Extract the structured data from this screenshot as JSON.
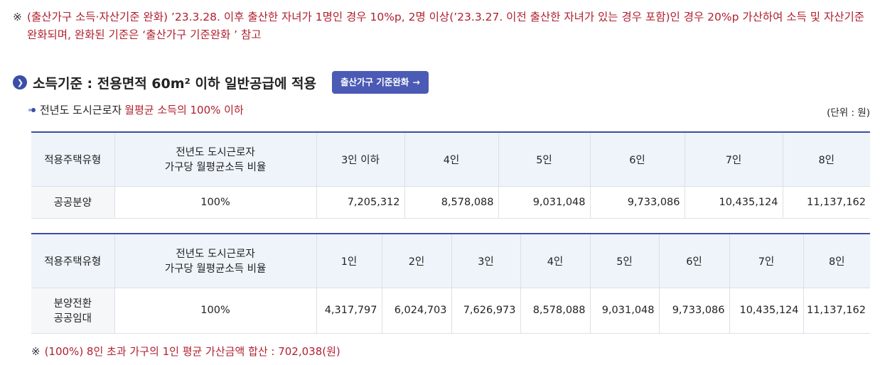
{
  "notes": {
    "top_mark": "※",
    "top_text": "(출산가구 소득·자산기준 완화) ’23.3.28. 이후 출산한 자녀가 1명인 경우 10%p, 2명 이상(’23.3.27. 이전 출산한 자녀가 있는 경우 포함)인 경우 20%p 가산하여 소득 및 자산기준 완화되며, 완화된 기준은 ‘출산가구 기준완화 ’ 참고",
    "bottom_mark": "※",
    "bottom_text": "(100%) 8인 초과 가구의 1인 평균 가산금액 합산 : 702,038(원)"
  },
  "section": {
    "title": "소득기준 : 전용면적 60m² 이하 일반공급에 적용",
    "button_label": "출산가구 기준완화",
    "button_arrow": "→",
    "bullet_icon": "chevron-right-icon"
  },
  "subtitle": {
    "prefix": "전년도 도시근로자",
    "highlight": "월평균 소득의 100% 이하"
  },
  "unit_label": "(단위 : 원)",
  "table1": {
    "header_type": "적용주택유형",
    "header_ratio_line1": "전년도 도시근로자",
    "header_ratio_line2": "가구당 월평균소득 비율",
    "columns": [
      "3인 이하",
      "4인",
      "5인",
      "6인",
      "7인",
      "8인"
    ],
    "row": {
      "type": "공공분양",
      "ratio": "100%",
      "values": [
        "7,205,312",
        "8,578,088",
        "9,031,048",
        "9,733,086",
        "10,435,124",
        "11,137,162"
      ]
    }
  },
  "table2": {
    "header_type": "적용주택유형",
    "header_ratio_line1": "전년도 도시근로자",
    "header_ratio_line2": "가구당 월평균소득 비율",
    "columns": [
      "1인",
      "2인",
      "3인",
      "4인",
      "5인",
      "6인",
      "7인",
      "8인"
    ],
    "row": {
      "type_line1": "분양전환",
      "type_line2": "공공임대",
      "ratio": "100%",
      "values": [
        "4,317,797",
        "6,024,703",
        "7,626,973",
        "8,578,088",
        "9,031,048",
        "9,733,086",
        "10,435,124",
        "11,137,162"
      ]
    }
  },
  "colors": {
    "accent_red": "#b0202e",
    "brand_blue": "#3d4f9f",
    "button_blue": "#4b5bb5",
    "header_bg": "#eef4fa"
  }
}
